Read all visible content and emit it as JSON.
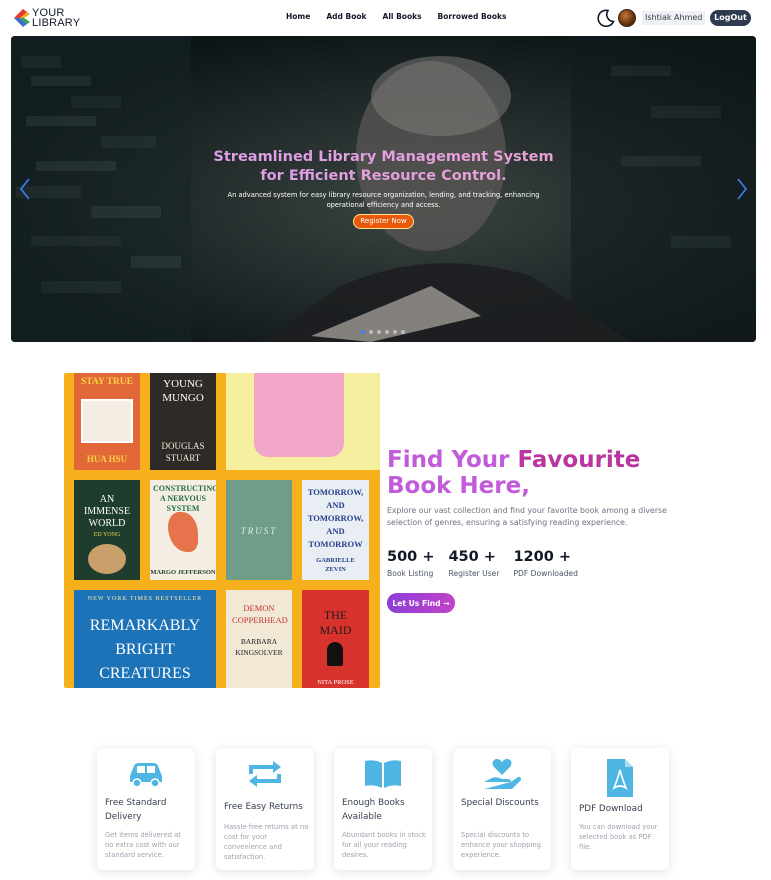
{
  "nav": {
    "logo_line1": "YOUR",
    "logo_line2": "LIBRARY",
    "links": [
      "Home",
      "Add Book",
      "All Books",
      "Borrowed Books"
    ],
    "username": "Ishtiak Ahmed",
    "logout_label": "LogOut"
  },
  "hero": {
    "title_line1": "Streamlined Library Management System",
    "title_line2": "for Efficient Resource Control.",
    "description": "An advanced system for easy library resource organization, lending, and tracking, enhancing operational efficiency and access.",
    "cta_label": "Register Now",
    "slide_count": 6,
    "active_slide": 1
  },
  "collage": {
    "books": [
      {
        "top": "STAY TRUE",
        "bottom": "HUA HSU"
      },
      {
        "top": "YOUNG MUNGO",
        "bottom": "DOUGLAS STUART"
      },
      {
        "top": "AN IMMENSE WORLD",
        "bottom": "ED YONG"
      },
      {
        "top": "CONSTRUCTING A NERVOUS SYSTEM",
        "bottom": "MARGO JEFFERSON"
      },
      {
        "top": "TRUST",
        "bottom": ""
      },
      {
        "top": "TOMORROW, AND TOMORROW, AND TOMORROW",
        "bottom": "GABRIELLE ZEVIN"
      },
      {
        "top": "NEW YORK TIMES BESTSELLER",
        "bottom": ""
      },
      {
        "top": "REMARKABLY BRIGHT CREATURES",
        "bottom": ""
      },
      {
        "top": "DEMON COPPERHEAD",
        "bottom": "BARBARA KINGSOLVER"
      },
      {
        "top": "THE MAID",
        "bottom": "NITA PROSE"
      }
    ]
  },
  "find": {
    "title_part1": "Find Your ",
    "title_part2": "Favourite",
    "title_part3": "Book Here,",
    "description": "Explore our vast collection and find your favorite book among a diverse selection of genres, ensuring a satisfying reading experience.",
    "stats": [
      {
        "value": "500 +",
        "label": "Book Listing"
      },
      {
        "value": "450 +",
        "label": "Register User"
      },
      {
        "value": "1200 +",
        "label": "PDF Downloaded"
      }
    ],
    "button_label": "Let Us Find"
  },
  "services": [
    {
      "icon": "car-icon",
      "title": "Free Standard Delivery",
      "desc": "Get items delivered at no extra cost with our standard service."
    },
    {
      "icon": "returns-icon",
      "title": "Free Easy Returns",
      "desc": "Hassle-free returns at no cost for your convenience and satisfaction."
    },
    {
      "icon": "book-open-icon",
      "title": "Enough Books Available",
      "desc": "Abundant books in stock for all your reading desires."
    },
    {
      "icon": "heart-hand-icon",
      "title": "Special Discounts",
      "desc": "Special discounts to enhance your shopping experience."
    },
    {
      "icon": "pdf-file-icon",
      "title": "PDF Download",
      "desc": "You can download your selected book as PDF file."
    }
  ],
  "colors": {
    "accent_purple": "#c25bd9",
    "cta_orange": "#ea580c",
    "logout_bg": "#2f3b4f",
    "icon_blue": "#4fb6e3"
  }
}
